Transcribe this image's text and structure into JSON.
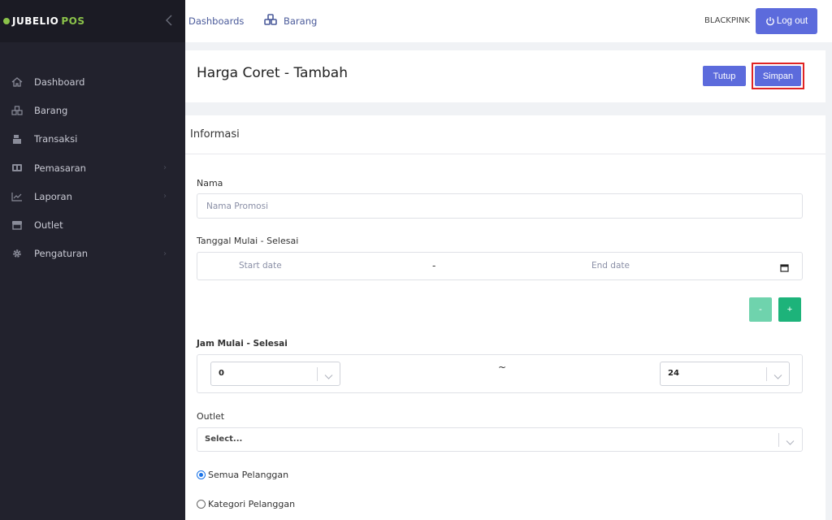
{
  "brand": {
    "name": "JUBELIO",
    "suffix": "POS"
  },
  "sidebar": {
    "items": [
      {
        "label": "Dashboard",
        "icon": "home-icon"
      },
      {
        "label": "Barang",
        "icon": "cubes-icon"
      },
      {
        "label": "Transaksi",
        "icon": "cash-register-icon"
      },
      {
        "label": "Pemasaran",
        "icon": "billboard-icon"
      },
      {
        "label": "Laporan",
        "icon": "chart-line-icon"
      },
      {
        "label": "Outlet",
        "icon": "store-icon"
      },
      {
        "label": "Pengaturan",
        "icon": "gear-icon"
      }
    ]
  },
  "topbar": {
    "crumbs": [
      "Dashboards",
      "Barang"
    ],
    "user": "BLACKPINK",
    "logout_label": "Log out"
  },
  "header": {
    "title": "Harga Coret - Tambah",
    "close_label": "Tutup",
    "save_label": "Simpan"
  },
  "form": {
    "section_title": "Informasi",
    "name_label": "Nama",
    "name_placeholder": "Nama Promosi",
    "date_label": "Tanggal Mulai - Selesai",
    "start_date_placeholder": "Start date",
    "end_date_placeholder": "End date",
    "date_separator": "-",
    "minus_label": "-",
    "plus_label": "+",
    "hour_label": "Jam Mulai - Selesai",
    "hour_start": "0",
    "hour_end": "24",
    "hour_separator": "~",
    "outlet_label": "Outlet",
    "outlet_placeholder": "Select...",
    "radio_all": "Semua Pelanggan",
    "radio_category": "Kategori Pelanggan"
  },
  "colors": {
    "accent": "#5c6bdc",
    "success": "#1db37a",
    "success_light": "#6fd3ad",
    "sidebar_bg": "#22222d",
    "highlight": "#e02424"
  }
}
